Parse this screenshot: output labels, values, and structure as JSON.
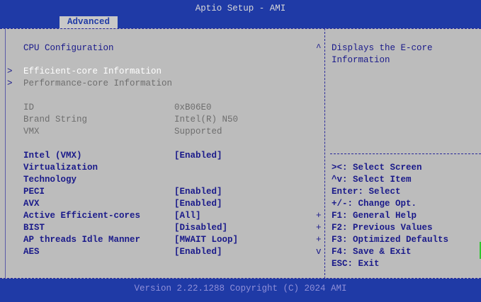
{
  "header": {
    "title": "Aptio Setup - AMI",
    "active_tab": "Advanced"
  },
  "page": {
    "heading": "CPU Configuration",
    "submenus": [
      "Efficient-core Information",
      "Performance-core Information"
    ],
    "info": [
      {
        "label": "ID",
        "value": "0xB06E0"
      },
      {
        "label": "Brand String",
        "value": "Intel(R) N50"
      },
      {
        "label": "VMX",
        "value": "Supported"
      }
    ],
    "settings": [
      {
        "label": "Intel (VMX)",
        "value": "[Enabled]"
      },
      {
        "label": "Virtualization",
        "value": ""
      },
      {
        "label": "Technology",
        "value": ""
      },
      {
        "label": "PECI",
        "value": "[Enabled]"
      },
      {
        "label": "AVX",
        "value": "[Enabled]"
      },
      {
        "label": "Active Efficient-cores",
        "value": "[All]"
      },
      {
        "label": "BIST",
        "value": "[Disabled]"
      },
      {
        "label": "AP threads Idle Manner",
        "value": "[MWAIT Loop]"
      },
      {
        "label": "AES",
        "value": "[Enabled]"
      }
    ]
  },
  "help": {
    "description": [
      "Displays the E-core",
      "Information"
    ],
    "keys": [
      "><: Select Screen",
      "^v: Select Item",
      "Enter: Select",
      "+/-: Change Opt.",
      "F1: General Help",
      "F2: Previous Values",
      "F3: Optimized Defaults",
      "F4: Save & Exit",
      "ESC: Exit"
    ]
  },
  "footer": {
    "version": "Version 2.22.1288 Copyright (C) 2024 AMI"
  },
  "colors": {
    "bar": "#1f3aa6",
    "panel": "#bcbcbc",
    "text": "#1a1a8a",
    "highlight": "#ffffff"
  }
}
